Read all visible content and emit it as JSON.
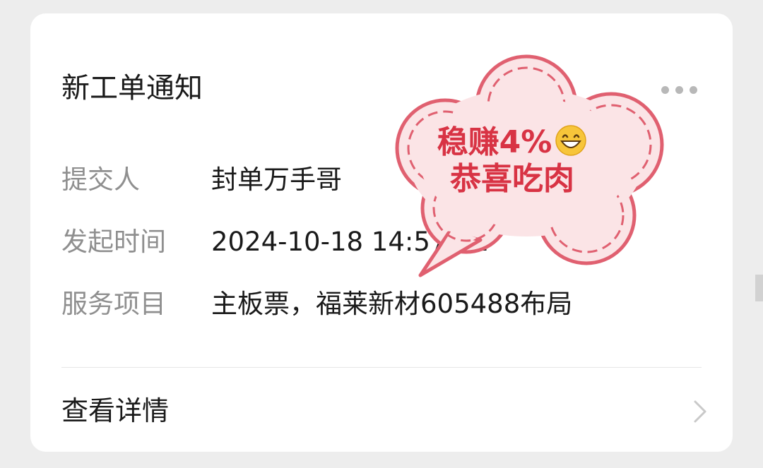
{
  "card": {
    "title": "新工单通知",
    "fields": [
      {
        "label": "提交人",
        "value": "封单万手哥"
      },
      {
        "label": "发起时间",
        "value": "2024-10-18 14:57:31"
      },
      {
        "label": "服务项目",
        "value": "主板票，福莱新材605488布局"
      }
    ],
    "detail_link": "查看详情",
    "more_icon": "more-dots-icon",
    "chevron_icon": "chevron-right-icon"
  },
  "sticker": {
    "line1": "稳赚4%",
    "line2": "恭喜吃肉",
    "emoji": "grinning-face-icon",
    "color": "#d83344",
    "fill": "#fbe4e6"
  }
}
